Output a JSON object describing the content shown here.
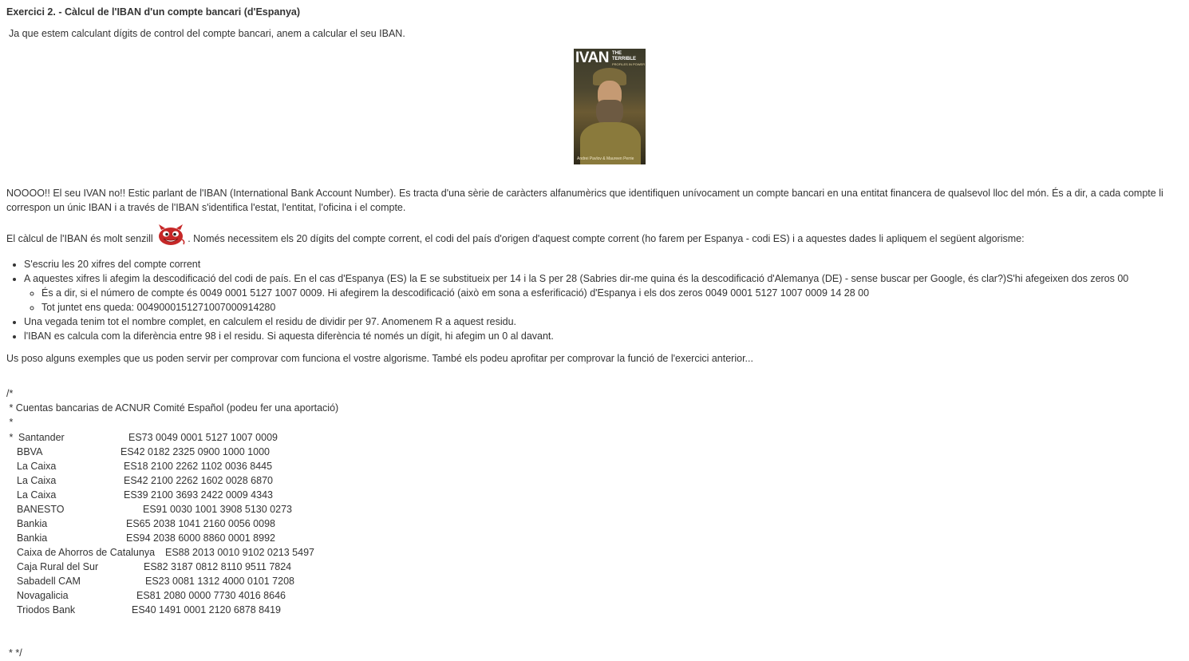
{
  "title": "Exercici 2. - Càlcul de l'IBAN d'un compte bancari (d'Espanya)",
  "intro": "Ja que estem calculant dígits de control del compte bancari, anem a calcular el seu IBAN.",
  "cover": {
    "title": "IVAN",
    "subtitle_line1": "THE",
    "subtitle_line2": "TERRIBLE",
    "subtitle_line3": "PROFILES IN POWER",
    "authors": "Andrei Pavlov & Maureen Perrie"
  },
  "paragraph1": "NOOOO!! El seu IVAN no!! Estic parlant de l'IBAN (International Bank Account Number). Es tracta d'una sèrie de caràcters alfanumèrics que identifiquen unívocament un compte bancari  en una entitat financera de qualsevol lloc del món. És a dir, a cada compte li correspon un únic IBAN i a través de l'IBAN s'identifica l'estat, l'entitat, l'oficina i el compte.",
  "paragraph2": {
    "before": "El càlcul de l'IBAN és molt senzill ",
    "after": ". Només necessitem els 20 dígits del compte corrent, el codi del país d'origen d'aquest compte corrent (ho farem per Espanya - codi ES) i a aquestes dades li apliquem el següent algorisme:",
    "emoticon": "devil-smiley-icon"
  },
  "list": {
    "item1": "S'escriu les 20 xifres del compte corrent",
    "item2": "A aquestes xifres li afegim la descodificació del codi de país. En el cas d'Espanya (ES) la E se substitueix per 14 i la S per 28 (Sabries dir-me quina és la descodificació d'Alemanya (DE) - sense buscar per Google, és clar?)S'hi afegeixen dos zeros 00",
    "sub1": "És a dir, si el número de compte és  0049 0001 5127 1007 0009. Hi afegirem la descodificació (això em sona a esferificació) d'Espanya i els dos zeros 0049 0001 5127 1007 0009 14 28 00",
    "sub2": "Tot juntet ens queda: 004900015127100700091428​0",
    "item3": "Una vegada tenim tot el nombre complet, en calculem el residu de dividir per 97. Anomenem R a aquest residu.",
    "item4": "l'IBAN es calcula com la diferència entre 98 i el residu. Si aquesta diferència té només un dígit, hi afegim un 0 al davant."
  },
  "paragraph3": "Us poso alguns exemples que us poden servir per comprovar com funciona el vostre algorisme. També els podeu aprofitar per comprovar la funció de l'exercici anterior...",
  "comment": {
    "open": "/*",
    "line1": " * Cuentas bancarias de ACNUR Comité Español (podeu fer una aportació)",
    "line2": " *",
    "star": " *",
    "close": " * */"
  },
  "banks": [
    {
      "name": "Santander",
      "iban": "ES73 0049 0001 5127 1007 0009"
    },
    {
      "name": "BBVA",
      "iban": "ES42 0182 2325 0900 1000 1000"
    },
    {
      "name": "La Caixa",
      "iban": "ES18 2100 2262 1102 0036 8445"
    },
    {
      "name": "La Caixa",
      "iban": "ES42 2100 2262 1602 0028 6870"
    },
    {
      "name": "La Caixa",
      "iban": "ES39 2100 3693 2422 0009 4343"
    },
    {
      "name": "BANESTO",
      "iban": "ES91 0030 1001 3908 5130 0273"
    },
    {
      "name": "Bankia",
      "iban": "ES65 2038 1041 2160 0056 0098"
    },
    {
      "name": "Bankia",
      "iban": "ES94 2038 6000 8860 0001 8992"
    },
    {
      "name": "Caixa de Ahorros de Catalunya",
      "iban": "ES88 2013 0010 9102 0213 5497"
    },
    {
      "name": "Caja Rural del Sur",
      "iban": "ES82 3187 0812 8110 9511 7824"
    },
    {
      "name": "Sabadell CAM",
      "iban": "ES23 0081 1312 4000 0101 7208"
    },
    {
      "name": "Novagalicia",
      "iban": "ES81 2080 0000 7730 4016 8646"
    },
    {
      "name": "Triodos Bank",
      "iban": "ES40 1491 0001 2120 6878 8419"
    }
  ]
}
